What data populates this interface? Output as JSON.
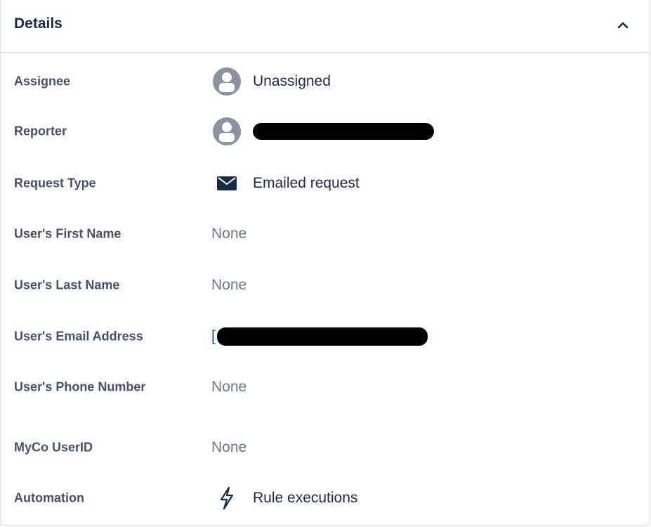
{
  "header": {
    "title": "Details"
  },
  "fields": {
    "assignee": {
      "label": "Assignee",
      "value": "Unassigned"
    },
    "reporter": {
      "label": "Reporter",
      "value": ""
    },
    "request_type": {
      "label": "Request Type",
      "value": "Emailed request"
    },
    "first_name": {
      "label": "User's First Name",
      "value": "None"
    },
    "last_name": {
      "label": "User's Last Name",
      "value": "None"
    },
    "email": {
      "label": "User's Email Address",
      "value_prefix": "["
    },
    "phone": {
      "label": "User's Phone Number",
      "value": "None"
    },
    "userid": {
      "label": "MyCo UserID",
      "value": "None"
    },
    "automation": {
      "label": "Automation",
      "value": "Rule executions"
    }
  },
  "icons": {
    "collapse": "chevron-up-icon",
    "assignee": "user-avatar-icon",
    "reporter": "user-avatar-icon",
    "request_type": "envelope-icon",
    "automation": "lightning-bolt-icon"
  },
  "colors": {
    "text": "#172b4d",
    "label": "#42526e",
    "muted": "#6b778c",
    "avatar": "#8993a4",
    "link": "#0052cc",
    "border": "#dfe1e6"
  }
}
